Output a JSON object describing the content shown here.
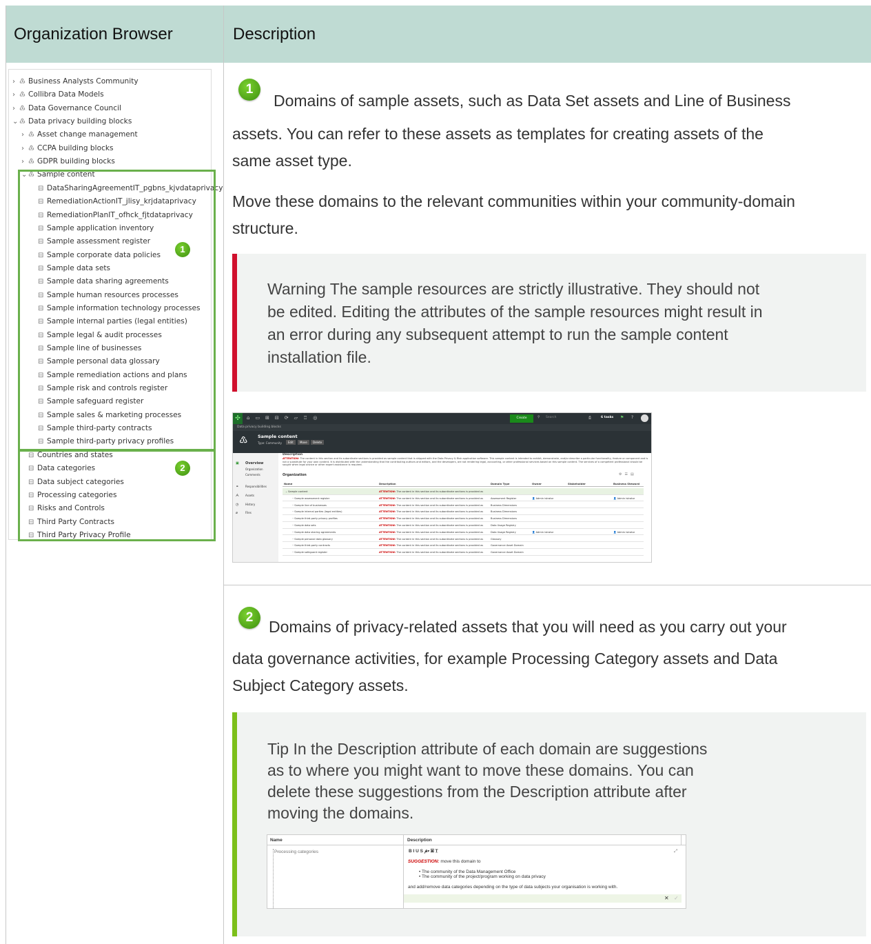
{
  "header": {
    "col1": "Organization Browser",
    "col2": "Description"
  },
  "tree": [
    {
      "label": "Business Analysts Community",
      "chev": ">",
      "icon": "community-icon",
      "indent": 0
    },
    {
      "label": "Collibra Data Models",
      "chev": ">",
      "icon": "community-icon",
      "indent": 0
    },
    {
      "label": "Data Governance Council",
      "chev": ">",
      "icon": "community-icon",
      "indent": 0
    },
    {
      "label": "Data privacy building blocks",
      "chev": "v",
      "icon": "community-icon",
      "indent": 0
    },
    {
      "label": "Asset change management",
      "chev": ">",
      "icon": "community-icon",
      "indent": 1
    },
    {
      "label": "CCPA building blocks",
      "chev": ">",
      "icon": "community-icon",
      "indent": 1
    },
    {
      "label": "GDPR building blocks",
      "chev": ">",
      "icon": "community-icon",
      "indent": 1
    },
    {
      "label": "Sample content",
      "chev": "v",
      "icon": "community-icon",
      "indent": 1
    },
    {
      "label": "DataSharingAgreementIT_pgbns_kjvdataprivacy",
      "chev": "",
      "icon": "domain-icon",
      "indent": 2
    },
    {
      "label": "RemediationActionIT_jlisy_krjdataprivacy",
      "chev": "",
      "icon": "domain-icon",
      "indent": 2
    },
    {
      "label": "RemediationPlanIT_ofhck_fjtdataprivacy",
      "chev": "",
      "icon": "domain-icon",
      "indent": 2
    },
    {
      "label": "Sample application inventory",
      "chev": "",
      "icon": "domain-icon",
      "indent": 2
    },
    {
      "label": "Sample assessment register",
      "chev": "",
      "icon": "domain-icon",
      "indent": 2
    },
    {
      "label": "Sample corporate data policies",
      "chev": "",
      "icon": "domain-icon",
      "indent": 2
    },
    {
      "label": "Sample data sets",
      "chev": "",
      "icon": "domain-icon",
      "indent": 2
    },
    {
      "label": "Sample data sharing agreements",
      "chev": "",
      "icon": "domain-icon",
      "indent": 2
    },
    {
      "label": "Sample human resources processes",
      "chev": "",
      "icon": "domain-icon",
      "indent": 2
    },
    {
      "label": "Sample information technology processes",
      "chev": "",
      "icon": "domain-icon",
      "indent": 2
    },
    {
      "label": "Sample internal parties (legal entities)",
      "chev": "",
      "icon": "domain-icon",
      "indent": 2
    },
    {
      "label": "Sample legal & audit processes",
      "chev": "",
      "icon": "domain-icon",
      "indent": 2
    },
    {
      "label": "Sample line of businesses",
      "chev": "",
      "icon": "domain-icon",
      "indent": 2
    },
    {
      "label": "Sample personal data glossary",
      "chev": "",
      "icon": "domain-icon",
      "indent": 2
    },
    {
      "label": "Sample remediation actions and plans",
      "chev": "",
      "icon": "domain-icon",
      "indent": 2
    },
    {
      "label": "Sample risk and controls register",
      "chev": "",
      "icon": "domain-icon",
      "indent": 2
    },
    {
      "label": "Sample safeguard register",
      "chev": "",
      "icon": "domain-icon",
      "indent": 2
    },
    {
      "label": "Sample sales & marketing processes",
      "chev": "",
      "icon": "domain-icon",
      "indent": 2
    },
    {
      "label": "Sample third-party contracts",
      "chev": "",
      "icon": "domain-icon",
      "indent": 2
    },
    {
      "label": "Sample third-party privacy profiles",
      "chev": "",
      "icon": "domain-icon",
      "indent": 2
    },
    {
      "label": "Countries and states",
      "chev": "",
      "icon": "domain-icon",
      "indent": 1
    },
    {
      "label": "Data categories",
      "chev": "",
      "icon": "domain-icon",
      "indent": 1
    },
    {
      "label": "Data subject categories",
      "chev": "",
      "icon": "domain-icon",
      "indent": 1
    },
    {
      "label": "Processing categories",
      "chev": "",
      "icon": "domain-icon",
      "indent": 1
    },
    {
      "label": "Risks and Controls",
      "chev": "",
      "icon": "domain-icon",
      "indent": 1
    },
    {
      "label": "Third Party Contracts",
      "chev": "",
      "icon": "domain-icon",
      "indent": 1
    },
    {
      "label": "Third Party Privacy Profile",
      "chev": "",
      "icon": "domain-icon",
      "indent": 1
    }
  ],
  "badges": {
    "one": "1",
    "two": "2"
  },
  "section1": {
    "line1": "Domains of sample assets, such as Data Set assets and Line of Business",
    "line2": "assets. You can refer to these assets as templates for creating assets of the",
    "line3": "same asset type.",
    "move1": "Move these domains to the relevant communities within your community-domain",
    "move2": "structure.",
    "warning1": "Warning   The sample resources are strictly illustrative. They should not",
    "warning2": "be edited. Editing the attributes of the sample resources might result in",
    "warning3": "an error during any subsequent attempt to run the sample content",
    "warning4": "installation file."
  },
  "section2": {
    "line1": "Domains of privacy-related assets that you will need as you carry out your",
    "line2": "data governance activities, for example Processing Category assets and Data",
    "line3": "Subject Category assets.",
    "tip1": "Tip   In the Description attribute of each domain are suggestions",
    "tip2": "as to where you might want to move these domains. You can",
    "tip3": "delete these suggestions from the Description attribute after",
    "tip4": "moving the domains."
  },
  "colors": {
    "header_bg": "#bfdbd3",
    "green_box": "#6ab04c",
    "warning_bar": "#d0102d",
    "tip_bar": "#7cbf1a",
    "note_bg": "#f1f3f2"
  },
  "shot1": {
    "breadcrumb": "Data privacy building blocks",
    "title": "Sample content",
    "type_label": "Type: Community",
    "btn_edit": "Edit",
    "btn_move": "Move",
    "btn_delete": "Delete",
    "create": "Create",
    "search": "Search",
    "tasks": "6 tasks",
    "nav": [
      "Overview",
      "Organization",
      "Comments",
      "Responsibilities",
      "Assets",
      "History",
      "Files"
    ],
    "desc_label": "Description",
    "attention": "ATTENTION:",
    "desc_text": "The content in this section and its subordinate sections is provided as sample content that is shipped with the Data Privacy & Risk application software. This sample content is intended to exhibit, demonstrate, and/or describe a particular functionality, feature or component and is not a substitute for your own content. It is distributed with the understanding that the contributing authors and editors, and the developers, are not rendering legal, accounting, or other professional services based on this sample content. The services of a competent professional should be sought when legal advice or other expert assistance is required.",
    "org_label": "Organization",
    "columns": [
      "Name",
      "Description",
      "Domain Type",
      "Owner",
      "Stakeholder",
      "Business Steward"
    ],
    "row_desc": "The content in this section and its subordinate sections is provided as",
    "rows": [
      {
        "name": "Sample content",
        "type": "",
        "owner": "",
        "steward": ""
      },
      {
        "name": "Sample assessment register",
        "type": "Assessment Register",
        "owner": "Admin istrator",
        "steward": "Admin istrator"
      },
      {
        "name": "Sample line of businesses",
        "type": "Business Dimensions",
        "owner": "",
        "steward": ""
      },
      {
        "name": "Sample internal parties (legal entities)",
        "type": "Business Dimensions",
        "owner": "",
        "steward": ""
      },
      {
        "name": "Sample third-party privacy profiles",
        "type": "Business Dimensions",
        "owner": "",
        "steward": ""
      },
      {
        "name": "Sample data sets",
        "type": "Data Usage Registry",
        "owner": "",
        "steward": ""
      },
      {
        "name": "Sample data sharing agreements",
        "type": "Data Usage Registry",
        "owner": "Admin istrator",
        "steward": "Admin istrator"
      },
      {
        "name": "Sample personal data glossary",
        "type": "Glossary",
        "owner": "",
        "steward": ""
      },
      {
        "name": "Sample third-party contracts",
        "type": "Governance Asset Domain",
        "owner": "",
        "steward": ""
      },
      {
        "name": "Sample safeguard register",
        "type": "Governance Asset Domain",
        "owner": "",
        "steward": ""
      }
    ]
  },
  "shot2": {
    "col_name": "Name",
    "col_desc": "Description",
    "row_name": "Processing categories",
    "toolbar": "B  I  U  S   𝓅▾  ▣   T̲",
    "suggestion": "SUGGESTION:",
    "sugg_text": " move this domain to",
    "bullet1": "The community of the Data Management Office",
    "bullet2": "The community of the project/program working on data privacy",
    "tail": "and add/remove data categories depending on the type of data subjects your organisation is working with.",
    "close": "✕"
  }
}
